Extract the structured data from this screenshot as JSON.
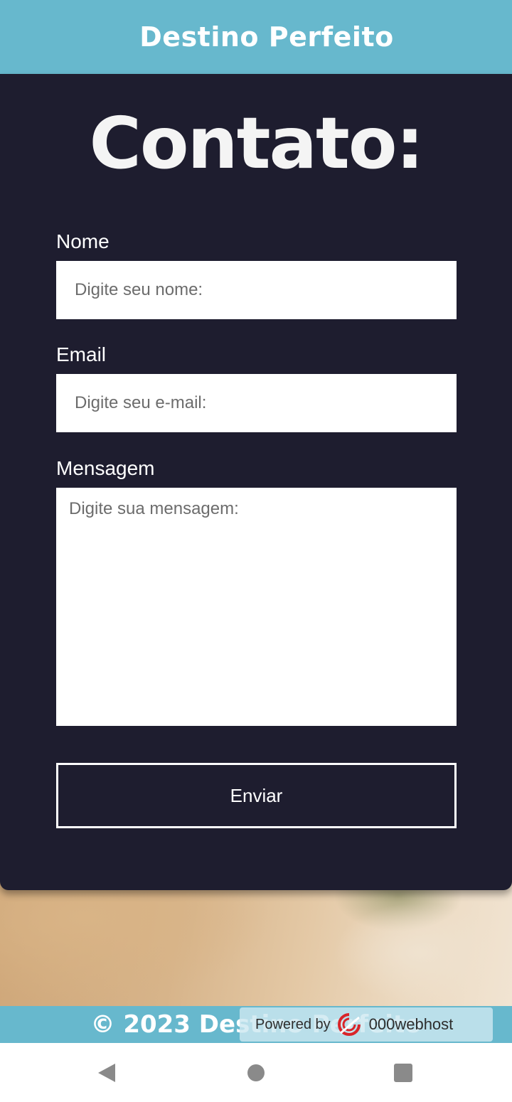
{
  "header": {
    "title": "Destino Perfeito"
  },
  "contact": {
    "title": "Contato:",
    "name_label": "Nome",
    "name_placeholder": "Digite seu nome:",
    "email_label": "Email",
    "email_placeholder": "Digite seu e-mail:",
    "message_label": "Mensagem",
    "message_placeholder": "Digite sua mensagem:",
    "submit_label": "Enviar"
  },
  "footer": {
    "text": "© 2023 Destino Perfeito",
    "powered_by": "Powered by",
    "host_name": "000webhost"
  },
  "android_nav": {
    "back_icon": "triangle-back-icon",
    "home_icon": "circle-home-icon",
    "recents_icon": "square-recents-icon"
  },
  "colors": {
    "header_bg": "#67b8cd",
    "card_bg": "#1e1d2f",
    "text_white": "#ffffff"
  }
}
